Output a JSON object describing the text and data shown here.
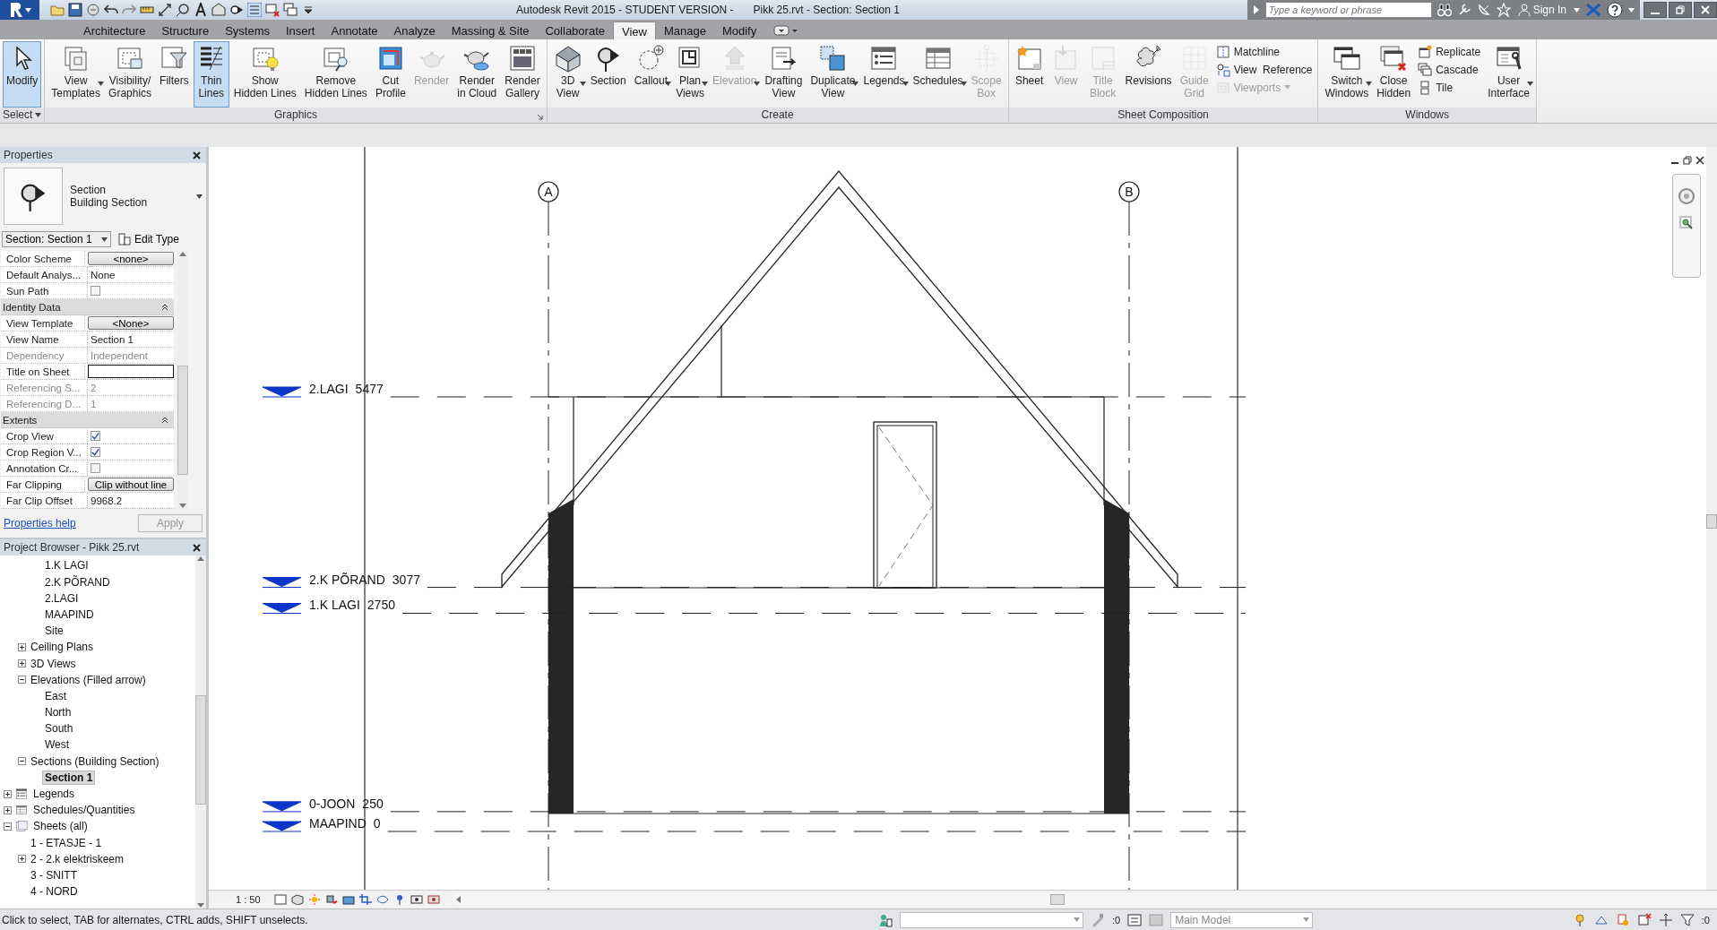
{
  "title_bar": {
    "title": "Autodesk Revit 2015 - STUDENT VERSION -",
    "document": "Pikk 25.rvt - Section: Section 1",
    "search": {
      "placeholder": "Type a keyword or phrase"
    },
    "sign_in": "Sign In"
  },
  "tabs": [
    {
      "label": "Architecture",
      "selected": false
    },
    {
      "label": "Structure",
      "selected": false
    },
    {
      "label": "Systems",
      "selected": false
    },
    {
      "label": "Insert",
      "selected": false
    },
    {
      "label": "Annotate",
      "selected": false
    },
    {
      "label": "Analyze",
      "selected": false
    },
    {
      "label": "Massing & Site",
      "selected": false
    },
    {
      "label": "Collaborate",
      "selected": false
    },
    {
      "label": "View",
      "selected": true
    },
    {
      "label": "Manage",
      "selected": false
    },
    {
      "label": "Modify",
      "selected": false
    }
  ],
  "ribbon": [
    {
      "title": "Select",
      "dropdown": true,
      "launcher": false,
      "buttons": [
        {
          "kind": "large",
          "label": "Modify",
          "selected": true,
          "disabled": false,
          "dropdown": false
        }
      ]
    },
    {
      "title": "Graphics",
      "dropdown": false,
      "launcher": true,
      "buttons": [
        {
          "kind": "large",
          "label": "View\nTemplates",
          "selected": false,
          "disabled": false,
          "dropdown": true
        },
        {
          "kind": "large",
          "label": "Visibility/\nGraphics",
          "selected": false,
          "disabled": false,
          "dropdown": false
        },
        {
          "kind": "large",
          "label": "Filters",
          "selected": false,
          "disabled": false,
          "dropdown": false
        },
        {
          "kind": "large",
          "label": "Thin\nLines",
          "selected": true,
          "disabled": false,
          "dropdown": false
        },
        {
          "kind": "large",
          "label": "Show\nHidden Lines",
          "selected": false,
          "disabled": false,
          "dropdown": false
        },
        {
          "kind": "large",
          "label": "Remove\nHidden Lines",
          "selected": false,
          "disabled": false,
          "dropdown": false
        },
        {
          "kind": "large",
          "label": "Cut\nProfile",
          "selected": false,
          "disabled": false,
          "dropdown": false
        },
        {
          "kind": "large",
          "label": "Render",
          "selected": false,
          "disabled": true,
          "dropdown": false
        },
        {
          "kind": "large",
          "label": "Render\nin Cloud",
          "selected": false,
          "disabled": false,
          "dropdown": false
        },
        {
          "kind": "large",
          "label": "Render\nGallery",
          "selected": false,
          "disabled": false,
          "dropdown": false
        }
      ]
    },
    {
      "title": "Create",
      "dropdown": false,
      "launcher": false,
      "buttons": [
        {
          "kind": "large",
          "label": "3D\nView",
          "selected": false,
          "disabled": false,
          "dropdown": true
        },
        {
          "kind": "large",
          "label": "Section",
          "selected": false,
          "disabled": false,
          "dropdown": false
        },
        {
          "kind": "large",
          "label": "Callout",
          "selected": false,
          "disabled": false,
          "dropdown": true
        },
        {
          "kind": "large",
          "label": "Plan\nViews",
          "selected": false,
          "disabled": false,
          "dropdown": true
        },
        {
          "kind": "large",
          "label": "Elevation",
          "selected": false,
          "disabled": true,
          "dropdown": true
        },
        {
          "kind": "large",
          "label": "Drafting\nView",
          "selected": false,
          "disabled": false,
          "dropdown": false
        },
        {
          "kind": "large",
          "label": "Duplicate\nView",
          "selected": false,
          "disabled": false,
          "dropdown": true
        },
        {
          "kind": "large",
          "label": "Legends",
          "selected": false,
          "disabled": false,
          "dropdown": true
        },
        {
          "kind": "large",
          "label": "Schedules",
          "selected": false,
          "disabled": false,
          "dropdown": true
        },
        {
          "kind": "large",
          "label": "Scope\nBox",
          "selected": false,
          "disabled": true,
          "dropdown": false
        }
      ]
    },
    {
      "title": "Sheet Composition",
      "dropdown": false,
      "launcher": false,
      "buttons": [
        {
          "kind": "large",
          "label": "Sheet",
          "selected": false,
          "disabled": false,
          "dropdown": false
        },
        {
          "kind": "large",
          "label": "View",
          "selected": false,
          "disabled": true,
          "dropdown": false
        },
        {
          "kind": "large",
          "label": "Title\nBlock",
          "selected": false,
          "disabled": true,
          "dropdown": false
        },
        {
          "kind": "large",
          "label": "Revisions",
          "selected": false,
          "disabled": false,
          "dropdown": false
        },
        {
          "kind": "large",
          "label": "Guide\nGrid",
          "selected": false,
          "disabled": true,
          "dropdown": false
        },
        {
          "kind": "small",
          "label": "Matchline",
          "selected": false,
          "disabled": false,
          "dropdown": false
        },
        {
          "kind": "small",
          "label": "View  Reference",
          "selected": false,
          "disabled": false,
          "dropdown": false
        },
        {
          "kind": "small",
          "label": "Viewports",
          "selected": false,
          "disabled": true,
          "dropdown": true
        }
      ]
    },
    {
      "title": "Windows",
      "dropdown": false,
      "launcher": false,
      "buttons": [
        {
          "kind": "large",
          "label": "Switch\nWindows",
          "selected": false,
          "disabled": false,
          "dropdown": true
        },
        {
          "kind": "large",
          "label": "Close\nHidden",
          "selected": false,
          "disabled": false,
          "dropdown": false
        },
        {
          "kind": "small",
          "label": "Replicate",
          "selected": false,
          "disabled": false,
          "dropdown": false
        },
        {
          "kind": "small",
          "label": "Cascade",
          "selected": false,
          "disabled": false,
          "dropdown": false
        },
        {
          "kind": "small",
          "label": "Tile",
          "selected": false,
          "disabled": false,
          "dropdown": false
        },
        {
          "kind": "large",
          "label": "User\nInterface",
          "selected": false,
          "disabled": false,
          "dropdown": true
        }
      ]
    }
  ],
  "properties": {
    "title": "Properties",
    "type_name": "Section",
    "type_family": "Building Section",
    "selector": "Section: Section 1",
    "edit_type": "Edit Type",
    "rows": [
      {
        "kind": "button",
        "name": "Color Scheme",
        "value": "<none>"
      },
      {
        "kind": "text",
        "name": "Default Analys...",
        "value": "None",
        "disabled": false
      },
      {
        "kind": "check",
        "name": "Sun Path",
        "checked": false
      },
      {
        "kind": "header",
        "name": "Identity Data",
        "expanded": true
      },
      {
        "kind": "button",
        "name": "View Template",
        "value": "<None>"
      },
      {
        "kind": "text",
        "name": "View Name",
        "value": "Section 1",
        "disabled": false
      },
      {
        "kind": "text",
        "name": "Dependency",
        "value": "Independent",
        "disabled": true
      },
      {
        "kind": "input",
        "name": "Title on Sheet"
      },
      {
        "kind": "text",
        "name": "Referencing S...",
        "value": "2",
        "disabled": true
      },
      {
        "kind": "text",
        "name": "Referencing D...",
        "value": "1",
        "disabled": true
      },
      {
        "kind": "header",
        "name": "Extents",
        "expanded": true
      },
      {
        "kind": "check",
        "name": "Crop View",
        "checked": true
      },
      {
        "kind": "check",
        "name": "Crop Region V...",
        "checked": true
      },
      {
        "kind": "check",
        "name": "Annotation Cr...",
        "checked": false
      },
      {
        "kind": "button",
        "name": "Far Clipping",
        "value": "Clip without line"
      },
      {
        "kind": "text",
        "name": "Far Clip Offset",
        "value": "9968.2",
        "disabled": false
      }
    ],
    "help_link": "Properties help",
    "apply": "Apply"
  },
  "project_browser": {
    "title": "Project Browser - Pikk 25.rvt",
    "tree": [
      {
        "children": [
          {
            "children": [
              {
                "label": "1.K LAGI",
                "selected": false
              },
              {
                "label": "2.K PÕRAND",
                "selected": false
              },
              {
                "label": "2.LAGI",
                "selected": false
              },
              {
                "label": "MAAPIND",
                "selected": false
              },
              {
                "label": "Site",
                "selected": false
              }
            ]
          },
          {
            "label": "Ceiling Plans",
            "expanded": false,
            "selected": false
          },
          {
            "label": "3D Views",
            "expanded": false,
            "selected": false
          },
          {
            "label": "Elevations (Filled arrow)",
            "expanded": true,
            "selected": false,
            "children": [
              {
                "label": "East",
                "selected": false
              },
              {
                "label": "North",
                "selected": false
              },
              {
                "label": "South",
                "selected": false
              },
              {
                "label": "West",
                "selected": false
              }
            ]
          },
          {
            "label": "Sections (Building Section)",
            "expanded": true,
            "selected": false,
            "children": [
              {
                "label": "Section 1",
                "selected": true
              }
            ]
          }
        ]
      },
      {
        "label": "Legends",
        "expanded": false,
        "selected": false
      },
      {
        "label": "Schedules/Quantities",
        "expanded": false,
        "selected": false
      },
      {
        "label": "Sheets (all)",
        "expanded": true,
        "selected": false,
        "children": [
          {
            "label": "1 - ETASJE - 1",
            "selected": false
          },
          {
            "label": "2 - 2.k elektriskeem",
            "expanded": false,
            "selected": false
          },
          {
            "label": "3 - SNITT",
            "selected": false
          },
          {
            "label": "4 - NORD",
            "selected": false
          }
        ]
      }
    ]
  },
  "view": {
    "grids": [
      {
        "label": "A"
      },
      {
        "label": "B"
      }
    ],
    "levels": [
      {
        "name": "2.LAGI",
        "elevation": "5477"
      },
      {
        "name": "2.K PÕRAND",
        "elevation": "3077"
      },
      {
        "name": "1.K LAGI",
        "elevation": "2750"
      },
      {
        "name": "0-JOON",
        "elevation": "250"
      },
      {
        "name": "MAAPIND",
        "elevation": "0"
      }
    ]
  },
  "view_bar": {
    "scale": "1 : 50"
  },
  "status_bar": {
    "message": "Click to select, TAB for alternates, CTRL adds, SHIFT unselects.",
    "count_1": ":0",
    "model": "Main Model",
    "count_2": ":0"
  }
}
